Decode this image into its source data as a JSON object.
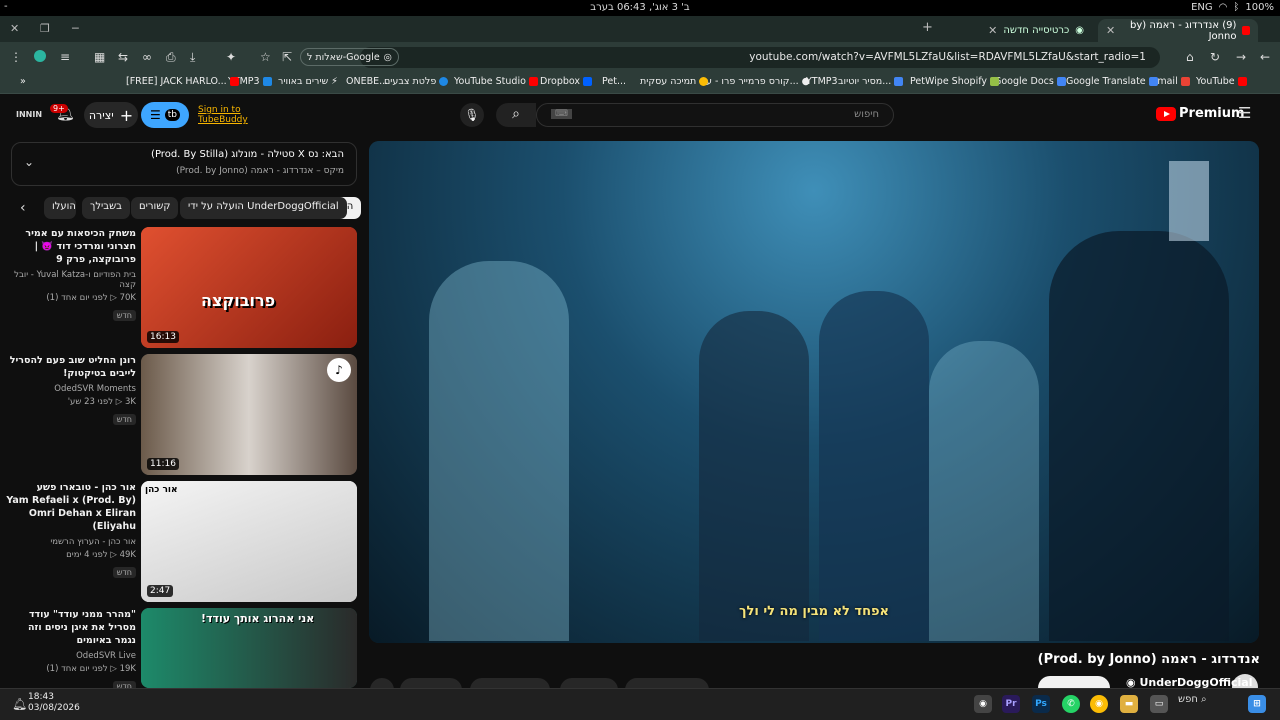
{
  "os": {
    "datetime": "ב' 3 אוג', 06:43 בערב",
    "lang": "ENG",
    "battery": "100%",
    "left_marker": "-"
  },
  "tabs": [
    {
      "label": "(9) אנדרדוג - ראמה (by Jonno",
      "active": true
    },
    {
      "label": "כרטיסייה חדשה",
      "active": false
    }
  ],
  "address": {
    "url": "youtube.com/watch?v=AVFML5LZfaU&list=RDAVFML5LZfaU&start_radio=1",
    "google_chip": "שאלות ל-Google"
  },
  "bookmarks": [
    {
      "label": "YouTube",
      "color": "#ff0000"
    },
    {
      "label": "Gmail",
      "color": "#ea4335"
    },
    {
      "label": "Google Translate",
      "color": "#4285f4"
    },
    {
      "label": "Google Docs",
      "color": "#4285f4"
    },
    {
      "label": "PetWipe Shopify",
      "color": "#95bf47"
    },
    {
      "label": "מסיר יוטיוב...",
      "color": "#4285f4"
    },
    {
      "label": "YTMP3",
      "color": "#555555"
    },
    {
      "label": "קורס פרמייר פרו - ע...",
      "color": "#777777"
    },
    {
      "label": "תמיכה עסקית",
      "color": "#fbbc05"
    },
    {
      "label": "Pet...",
      "color": "#ffffff"
    },
    {
      "label": "Dropbox",
      "color": "#0061ff"
    },
    {
      "label": "YouTube Studio",
      "color": "#ff0000"
    },
    {
      "label": "פלטת צבעים",
      "color": "#1e88e5"
    },
    {
      "label": "ONEBE...",
      "color": "#cccccc"
    },
    {
      "label": "שירים באוויר",
      "color": "#1e88e5"
    },
    {
      "label": "YTMP3",
      "color": "#ff0000"
    },
    {
      "label": "[FREE] JACK HARLO...",
      "color": "#ff0000"
    }
  ],
  "youtube": {
    "search_placeholder": "חיפוש",
    "premium": "Premium",
    "create_label": "יצירה",
    "notif_count": "9+",
    "signin_line1": "Sign in to",
    "signin_line2": "TubeBuddy",
    "tubebuddy_short": "tb"
  },
  "playlist": {
    "now_title": "הבא: נס X סטילה - מונלוג (Prod. By Stilla)",
    "mix_subtitle": "מיקס – אנדרדוג - ראמה (Prod. by Jonno)"
  },
  "chips": [
    "הכול",
    "הועלה על ידי UnderDoggOfficial",
    "קשורים",
    "בשבילך",
    "הועלו"
  ],
  "videos": [
    {
      "title": "משחק הכיסאות עם אמיר חצרוני ומרדכי דוד 👿 | פרובוקצה, פרק 9",
      "channel": "בית הפודיום ו-Yuval Katza - יובל קצה",
      "stats": "70K ▷ לפני יום אחד (1)",
      "badge": "חדש",
      "duration": "16:13",
      "thumb_bg": "#d94a2a",
      "thumb_text": "פרובוקצה"
    },
    {
      "title": "רונן החליט שוב פעם להסריל לייבים בטיקטוק!",
      "channel": "OdedSVR Moments",
      "stats": "3K ▷ לפני 23 שע'",
      "badge": "חדש",
      "duration": "11:16",
      "thumb_bg": "#3a3a3a",
      "thumb_text": ""
    },
    {
      "title": "אור כהן - טובארו פשע (Prod. By) Yam Refaeli x Omri Dehan x Eliran Eliyahu)",
      "channel": "אור כהן - הערוץ הרשמי",
      "stats": "49K ▷ לפני 4 ימים",
      "badge": "חדש",
      "duration": "2:47",
      "thumb_bg": "#e8e8e8",
      "thumb_text": "אור כהן"
    },
    {
      "title": "\"מהרר ממני עודד\" עודד מסריל את איגן ניסים וזה נגמר באיומים",
      "channel": "OdedSVR Live",
      "stats": "19K ▷ לפני יום אחד (1)",
      "badge": "חדש",
      "duration": "",
      "thumb_bg": "#2a6b5a",
      "thumb_text": "אני אהרוג אותך עודד!"
    }
  ],
  "player": {
    "subtitle": "אפחד לא מבין מה לי ולך",
    "title": "אנדרדוג - ראמה (Prod. by Jonno)",
    "channel": "UnderDoggOfficial"
  },
  "taskbar": {
    "time": "18:43",
    "date": "03/08/2026",
    "search": "חפש"
  }
}
